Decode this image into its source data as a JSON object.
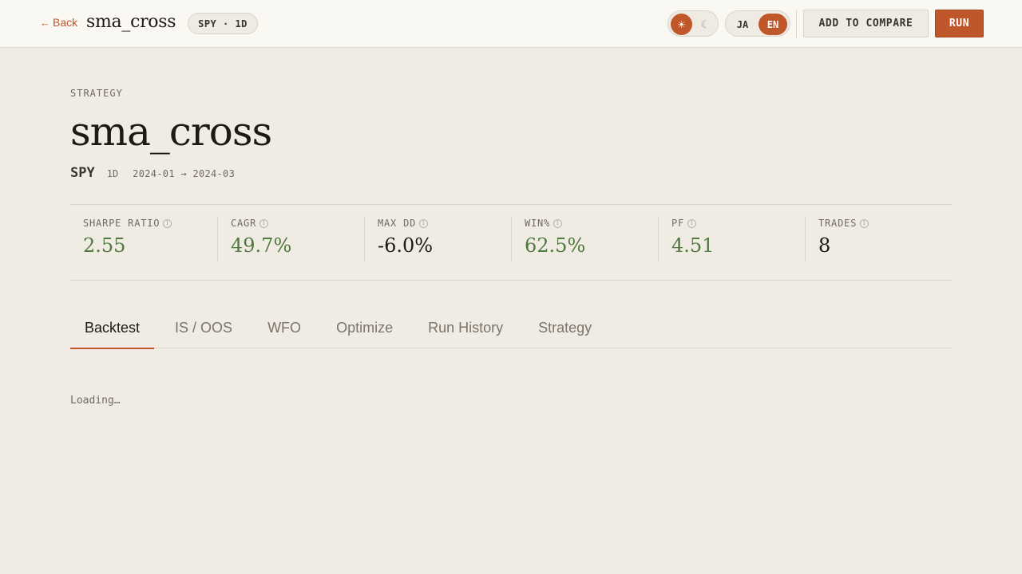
{
  "topbar": {
    "back_label": "Back",
    "title": "sma_cross",
    "badge": "SPY · 1D",
    "theme": {
      "light_icon": "sun-icon",
      "dark_icon": "moon-icon",
      "active": "light"
    },
    "lang": {
      "ja": "JA",
      "en": "EN",
      "active": "EN"
    },
    "compare_label": "ADD TO COMPARE",
    "run_label": "RUN"
  },
  "header": {
    "eyebrow": "STRATEGY",
    "title": "sma_cross",
    "symbol": "SPY",
    "timeframe": "1D",
    "range": "2024-01 → 2024-03"
  },
  "metrics": [
    {
      "label": "SHARPE RATIO",
      "value": "2.55",
      "positive": true
    },
    {
      "label": "CAGR",
      "value": "49.7%",
      "positive": true
    },
    {
      "label": "MAX DD",
      "value": "-6.0%",
      "positive": false
    },
    {
      "label": "WIN%",
      "value": "62.5%",
      "positive": true
    },
    {
      "label": "PF",
      "value": "4.51",
      "positive": true
    },
    {
      "label": "TRADES",
      "value": "8",
      "positive": false
    }
  ],
  "tabs": [
    {
      "label": "Backtest",
      "active": true
    },
    {
      "label": "IS / OOS",
      "active": false
    },
    {
      "label": "WFO",
      "active": false
    },
    {
      "label": "Optimize",
      "active": false
    },
    {
      "label": "Run History",
      "active": false
    },
    {
      "label": "Strategy",
      "active": false
    }
  ],
  "content": {
    "loading": "Loading…"
  },
  "colors": {
    "accent": "#c0572b",
    "positive": "#4e7a3e",
    "background": "#f0ece4"
  }
}
